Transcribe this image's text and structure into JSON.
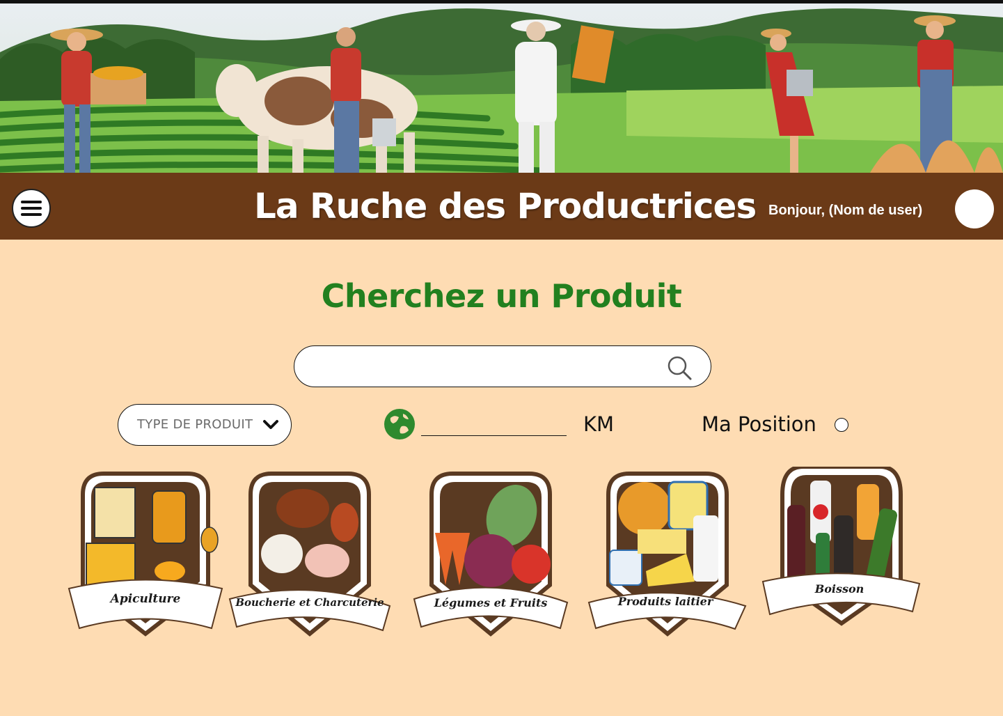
{
  "header": {
    "title": "La Ruche des Productrices",
    "greeting": "Bonjour, (Nom de user)"
  },
  "main": {
    "heading": "Cherchez un Produit",
    "search": {
      "value": "",
      "placeholder": ""
    },
    "filters": {
      "product_type": "TYPE DE PRODUIT",
      "distance_value": "",
      "distance_unit": "KM",
      "position_label": "Ma Position",
      "position_checked": false
    }
  },
  "categories": [
    {
      "label": "Apiculture",
      "icon": "honey-icon"
    },
    {
      "label": "Boucherie et Charcuterie",
      "icon": "livestock-icon"
    },
    {
      "label": "Légumes et Fruits",
      "icon": "vegetables-icon"
    },
    {
      "label": "Produits laitier",
      "icon": "dairy-icon"
    },
    {
      "label": "Boisson",
      "icon": "drinks-icon"
    }
  ],
  "colors": {
    "background": "#fedcb3",
    "header_bar": "#6b3a17",
    "heading": "#22801f",
    "badge_frame": "#5a3a22"
  }
}
